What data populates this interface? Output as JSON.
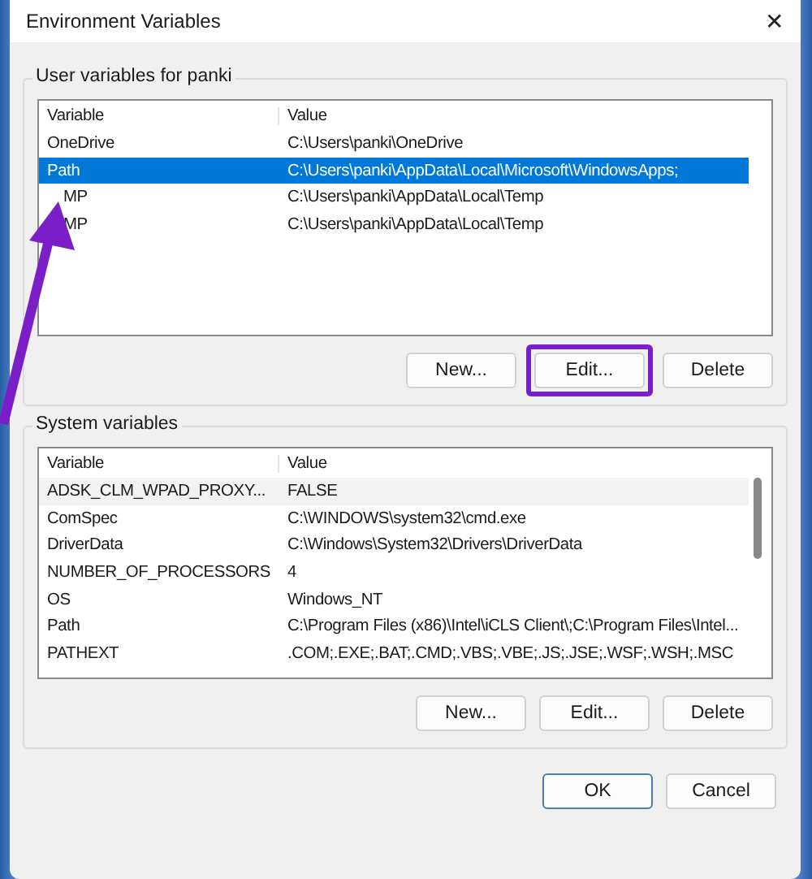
{
  "window": {
    "title": "Environment Variables",
    "close_glyph": "✕"
  },
  "user_variables": {
    "title": "User variables for panki",
    "columns": [
      "Variable",
      "Value"
    ],
    "rows": [
      {
        "variable": "OneDrive",
        "value": "C:\\Users\\panki\\OneDrive",
        "selected": false
      },
      {
        "variable": "Path",
        "value": "C:\\Users\\panki\\AppData\\Local\\Microsoft\\WindowsApps;",
        "selected": true
      },
      {
        "variable": "MP",
        "value": "C:\\Users\\panki\\AppData\\Local\\Temp",
        "selected": false
      },
      {
        "variable": "MP",
        "value": "C:\\Users\\panki\\AppData\\Local\\Temp",
        "selected": false
      }
    ],
    "buttons": [
      {
        "label": "New...",
        "highlighted": false
      },
      {
        "label": "Edit...",
        "highlighted": true
      },
      {
        "label": "Delete",
        "highlighted": false
      }
    ]
  },
  "system_variables": {
    "title": "System variables",
    "columns": [
      "Variable",
      "Value"
    ],
    "rows": [
      {
        "variable": "ADSK_CLM_WPAD_PROXY...",
        "value": "FALSE",
        "selected": false
      },
      {
        "variable": "ComSpec",
        "value": "C:\\WINDOWS\\system32\\cmd.exe",
        "selected": false
      },
      {
        "variable": "DriverData",
        "value": "C:\\Windows\\System32\\Drivers\\DriverData",
        "selected": false
      },
      {
        "variable": "NUMBER_OF_PROCESSORS",
        "value": "4",
        "selected": false
      },
      {
        "variable": "OS",
        "value": "Windows_NT",
        "selected": false
      },
      {
        "variable": "Path",
        "value": "C:\\Program Files (x86)\\Intel\\iCLS Client\\;C:\\Program Files\\Intel...",
        "selected": false
      },
      {
        "variable": "PATHEXT",
        "value": ".COM;.EXE;.BAT;.CMD;.VBS;.VBE;.JS;.JSE;.WSF;.WSH;.MSC",
        "selected": false
      }
    ],
    "buttons": [
      {
        "label": "New...",
        "highlighted": false
      },
      {
        "label": "Edit...",
        "highlighted": false
      },
      {
        "label": "Delete",
        "highlighted": false
      }
    ]
  },
  "dialog_buttons": [
    {
      "label": "OK",
      "default": true
    },
    {
      "label": "Cancel",
      "default": false
    }
  ]
}
